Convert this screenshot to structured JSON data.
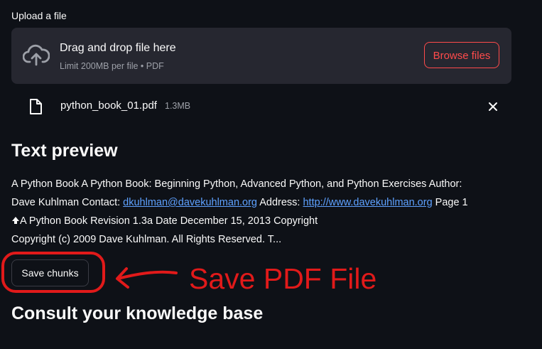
{
  "uploader": {
    "label": "Upload a file",
    "drop_title": "Drag and drop file here",
    "limit_text": "Limit 200MB per file • PDF",
    "browse_label": "Browse files"
  },
  "file": {
    "name": "python_book_01.pdf",
    "size": "1.3MB"
  },
  "preview": {
    "title": "Text preview",
    "line1": "A Python Book A Python Book: Beginning Python, Advanced Python, and Python Exercises Author:",
    "line2_prefix": "Dave Kuhlman Contact: ",
    "email": "dkuhlman@davekuhlman.org",
    "line2_mid": " Address: ",
    "url": "http://www.davekuhlman.org",
    "line2_suffix": " Page 1",
    "line3": "A Python Book Revision 1.3a Date December 15, 2013 Copyright",
    "line4": "Copyright (c) 2009 Dave Kuhlman. All Rights Reserved. T..."
  },
  "actions": {
    "save_label": "Save chunks"
  },
  "annotation": {
    "text": "Save PDF File",
    "color": "#e11a1a"
  },
  "kb": {
    "title": "Consult your knowledge base"
  },
  "colors": {
    "background": "#0e1117",
    "dropzone": "#262730",
    "accent": "#ff4b4b",
    "link": "#5ea1ff"
  },
  "icons": {
    "upload": "cloud-upload-icon",
    "file": "file-icon",
    "close": "close-icon"
  }
}
